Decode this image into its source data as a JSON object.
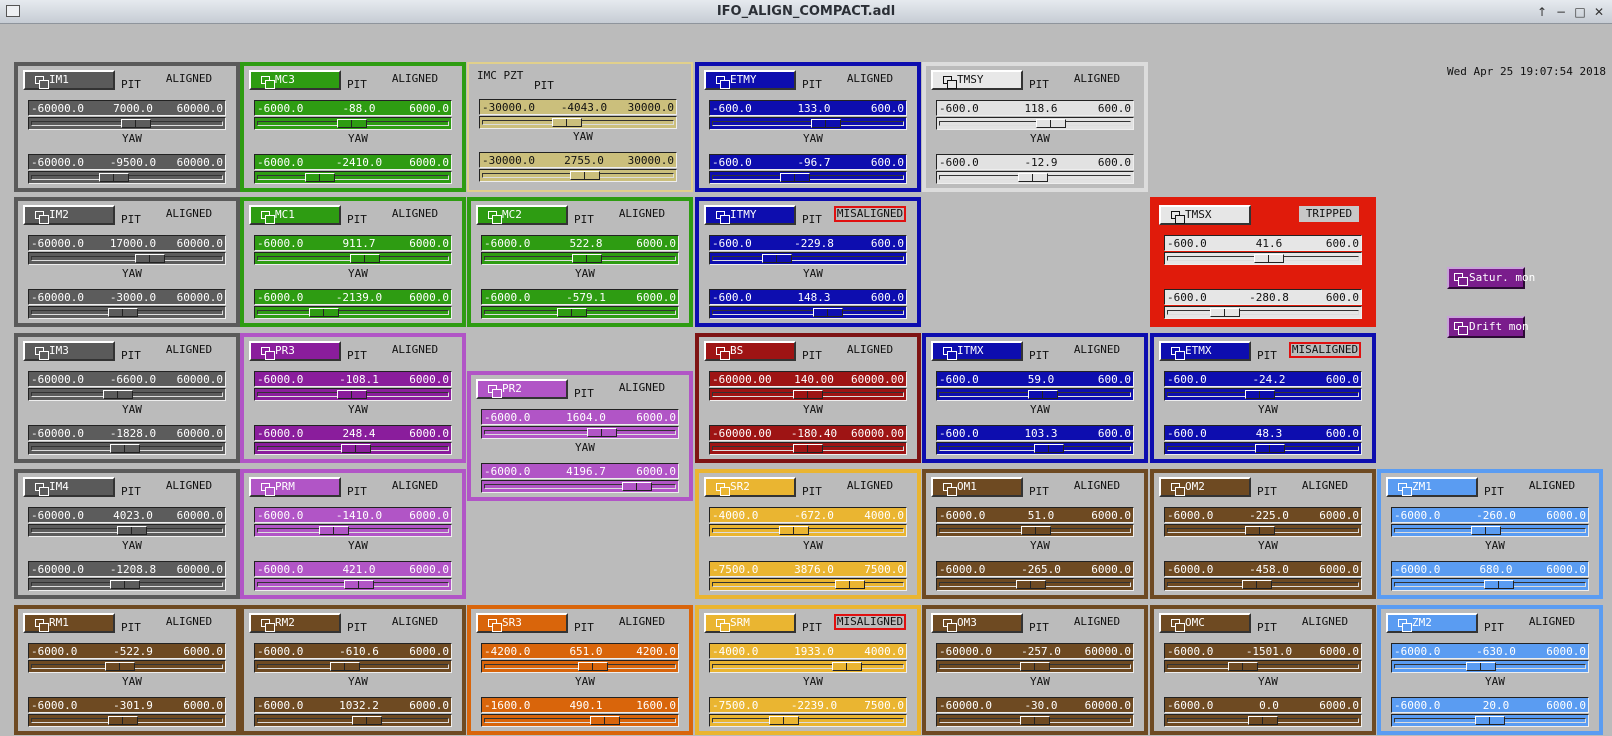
{
  "window": {
    "title": "IFO_ALIGN_COMPACT.adl",
    "controls": [
      "↑",
      "−",
      "□",
      "✕"
    ]
  },
  "clock": "Wed Apr 25 19:07:54 2018",
  "labels": {
    "pit": "PIT",
    "yaw": "YAW"
  },
  "side_buttons": [
    {
      "label": "Satur. mon"
    },
    {
      "label": "Drift mon"
    }
  ],
  "colors": {
    "gray": {
      "border": "#5a5a5a",
      "btn": "#5a5a5a",
      "fill": "#5c5c5c",
      "text": "#fff"
    },
    "green": {
      "border": "#2e9c12",
      "btn": "#2e9c12",
      "fill": "#2e9c12",
      "text": "#fff"
    },
    "pzt": {
      "border": "#e1d08c",
      "fill": "#cbbf7c",
      "text": "#111"
    },
    "blue": {
      "border": "#0d0daf",
      "btn": "#0d0daf",
      "fill": "#0d0daf",
      "text": "#fff"
    },
    "silver": {
      "border": "#dcdcdc",
      "btn": "#e8e8e8",
      "fill": "#e2e2e2",
      "text": "#111"
    },
    "purple": {
      "border": "#b155c6",
      "btn": "#8a1d9c",
      "fill": "#8a1d9c",
      "text": "#fff"
    },
    "lilac": {
      "border": "#b155c6",
      "btn": "#b155c6",
      "fill": "#b155c6",
      "text": "#fff"
    },
    "maroon": {
      "border": "#7e1313",
      "btn": "#9e1414",
      "fill": "#9e1414",
      "text": "#fff"
    },
    "yellow": {
      "border": "#eab531",
      "btn": "#eab531",
      "fill": "#eab531",
      "text": "#fff"
    },
    "brown": {
      "border": "#6e4a22",
      "btn": "#6e4a22",
      "fill": "#6e4a22",
      "text": "#fff"
    },
    "orange": {
      "border": "#d9650b",
      "btn": "#d9650b",
      "fill": "#d9650b",
      "text": "#fff"
    },
    "skyblue": {
      "border": "#5a9cf2",
      "btn": "#5a9cf2",
      "fill": "#5a9cf2",
      "text": "#fff"
    },
    "red": {
      "border": "#e01b0b",
      "fill": "#e6e6e6",
      "text": "#111"
    }
  },
  "panels": [
    {
      "name": "IM1",
      "theme": "gray",
      "status": "ALIGNED",
      "pit": {
        "lo": "-60000.0",
        "cur": "7000.0",
        "hi": "60000.0"
      },
      "yaw": {
        "lo": "-60000.0",
        "cur": "-9500.0",
        "hi": "60000.0"
      }
    },
    {
      "name": "MC3",
      "theme": "green",
      "status": "ALIGNED",
      "pit": {
        "lo": "-6000.0",
        "cur": "-88.0",
        "hi": "6000.0"
      },
      "yaw": {
        "lo": "-6000.0",
        "cur": "-2410.0",
        "hi": "6000.0"
      }
    },
    {
      "name": "IMC PZT",
      "theme": "pzt",
      "special": "pzt",
      "pit": {
        "lo": "-30000.0",
        "cur": "-4043.0",
        "hi": "30000.0"
      },
      "yaw": {
        "lo": "-30000.0",
        "cur": "2755.0",
        "hi": "30000.0"
      }
    },
    {
      "name": "ETMY",
      "theme": "blue",
      "status": "ALIGNED",
      "pit": {
        "lo": "-600.0",
        "cur": "133.0",
        "hi": "600.0"
      },
      "yaw": {
        "lo": "-600.0",
        "cur": "-96.7",
        "hi": "600.0"
      }
    },
    {
      "name": "TMSY",
      "theme": "silver",
      "status": "ALIGNED",
      "pit": {
        "lo": "-600.0",
        "cur": "118.6",
        "hi": "600.0"
      },
      "yaw": {
        "lo": "-600.0",
        "cur": "-12.9",
        "hi": "600.0"
      }
    },
    {
      "name": "IM2",
      "theme": "gray",
      "status": "ALIGNED",
      "pit": {
        "lo": "-60000.0",
        "cur": "17000.0",
        "hi": "60000.0"
      },
      "yaw": {
        "lo": "-60000.0",
        "cur": "-3000.0",
        "hi": "60000.0"
      }
    },
    {
      "name": "MC1",
      "theme": "green",
      "status": "ALIGNED",
      "pit": {
        "lo": "-6000.0",
        "cur": "911.7",
        "hi": "6000.0"
      },
      "yaw": {
        "lo": "-6000.0",
        "cur": "-2139.0",
        "hi": "6000.0"
      }
    },
    {
      "name": "MC2",
      "theme": "green",
      "status": "ALIGNED",
      "pit": {
        "lo": "-6000.0",
        "cur": "522.8",
        "hi": "6000.0"
      },
      "yaw": {
        "lo": "-6000.0",
        "cur": "-579.1",
        "hi": "6000.0"
      }
    },
    {
      "name": "ITMY",
      "theme": "blue",
      "status": "MISALIGNED",
      "pit": {
        "lo": "-600.0",
        "cur": "-229.8",
        "hi": "600.0"
      },
      "yaw": {
        "lo": "-600.0",
        "cur": "148.3",
        "hi": "600.0"
      }
    },
    {
      "name": "TMSX",
      "theme": "red",
      "status": "TRIPPED",
      "special": "tripped",
      "pit": {
        "lo": "-600.0",
        "cur": "41.6",
        "hi": "600.0"
      },
      "yaw": {
        "lo": "-600.0",
        "cur": "-280.8",
        "hi": "600.0"
      }
    },
    {
      "name": "IM3",
      "theme": "gray",
      "status": "ALIGNED",
      "pit": {
        "lo": "-60000.0",
        "cur": "-6600.0",
        "hi": "60000.0"
      },
      "yaw": {
        "lo": "-60000.0",
        "cur": "-1828.0",
        "hi": "60000.0"
      }
    },
    {
      "name": "PR3",
      "theme": "purple",
      "status": "ALIGNED",
      "pit": {
        "lo": "-6000.0",
        "cur": "-108.1",
        "hi": "6000.0"
      },
      "yaw": {
        "lo": "-6000.0",
        "cur": "248.4",
        "hi": "6000.0"
      }
    },
    {
      "name": "PR2",
      "theme": "lilac",
      "status": "ALIGNED",
      "pit": {
        "lo": "-6000.0",
        "cur": "1604.0",
        "hi": "6000.0"
      },
      "yaw": {
        "lo": "-6000.0",
        "cur": "4196.7",
        "hi": "6000.0"
      }
    },
    {
      "name": "BS",
      "theme": "maroon",
      "status": "ALIGNED",
      "pit": {
        "lo": "-60000.00",
        "cur": "140.00",
        "hi": "60000.00"
      },
      "yaw": {
        "lo": "-60000.00",
        "cur": "-180.40",
        "hi": "60000.00"
      }
    },
    {
      "name": "ITMX",
      "theme": "blue",
      "status": "ALIGNED",
      "pit": {
        "lo": "-600.0",
        "cur": "59.0",
        "hi": "600.0"
      },
      "yaw": {
        "lo": "-600.0",
        "cur": "103.3",
        "hi": "600.0"
      }
    },
    {
      "name": "ETMX",
      "theme": "blue",
      "status": "MISALIGNED",
      "pit": {
        "lo": "-600.0",
        "cur": "-24.2",
        "hi": "600.0"
      },
      "yaw": {
        "lo": "-600.0",
        "cur": "48.3",
        "hi": "600.0"
      }
    },
    {
      "name": "IM4",
      "theme": "gray",
      "status": "ALIGNED",
      "pit": {
        "lo": "-60000.0",
        "cur": "4023.0",
        "hi": "60000.0"
      },
      "yaw": {
        "lo": "-60000.0",
        "cur": "-1208.8",
        "hi": "60000.0"
      }
    },
    {
      "name": "PRM",
      "theme": "lilac",
      "status": "ALIGNED",
      "pit": {
        "lo": "-6000.0",
        "cur": "-1410.0",
        "hi": "6000.0"
      },
      "yaw": {
        "lo": "-6000.0",
        "cur": "421.0",
        "hi": "6000.0"
      }
    },
    {
      "name": "SR2",
      "theme": "yellow",
      "status": "ALIGNED",
      "pit": {
        "lo": "-4000.0",
        "cur": "-672.0",
        "hi": "4000.0"
      },
      "yaw": {
        "lo": "-7500.0",
        "cur": "3876.0",
        "hi": "7500.0"
      }
    },
    {
      "name": "OM1",
      "theme": "brown",
      "status": "ALIGNED",
      "pit": {
        "lo": "-6000.0",
        "cur": "51.0",
        "hi": "6000.0"
      },
      "yaw": {
        "lo": "-6000.0",
        "cur": "-265.0",
        "hi": "6000.0"
      }
    },
    {
      "name": "OM2",
      "theme": "brown",
      "status": "ALIGNED",
      "pit": {
        "lo": "-6000.0",
        "cur": "-225.0",
        "hi": "6000.0"
      },
      "yaw": {
        "lo": "-6000.0",
        "cur": "-458.0",
        "hi": "6000.0"
      }
    },
    {
      "name": "ZM1",
      "theme": "skyblue",
      "status": "ALIGNED",
      "pit": {
        "lo": "-6000.0",
        "cur": "-260.0",
        "hi": "6000.0"
      },
      "yaw": {
        "lo": "-6000.0",
        "cur": "680.0",
        "hi": "6000.0"
      }
    },
    {
      "name": "RM1",
      "theme": "brown",
      "status": "ALIGNED",
      "pit": {
        "lo": "-6000.0",
        "cur": "-522.9",
        "hi": "6000.0"
      },
      "yaw": {
        "lo": "-6000.0",
        "cur": "-301.9",
        "hi": "6000.0"
      }
    },
    {
      "name": "RM2",
      "theme": "brown",
      "status": "ALIGNED",
      "pit": {
        "lo": "-6000.0",
        "cur": "-610.6",
        "hi": "6000.0"
      },
      "yaw": {
        "lo": "-6000.0",
        "cur": "1032.2",
        "hi": "6000.0"
      }
    },
    {
      "name": "SR3",
      "theme": "orange",
      "status": "ALIGNED",
      "pit": {
        "lo": "-4200.0",
        "cur": "651.0",
        "hi": "4200.0"
      },
      "yaw": {
        "lo": "-1600.0",
        "cur": "490.1",
        "hi": "1600.0"
      }
    },
    {
      "name": "SRM",
      "theme": "yellow",
      "status": "MISALIGNED",
      "pit": {
        "lo": "-4000.0",
        "cur": "1933.0",
        "hi": "4000.0"
      },
      "yaw": {
        "lo": "-7500.0",
        "cur": "-2239.0",
        "hi": "7500.0"
      }
    },
    {
      "name": "OM3",
      "theme": "brown",
      "status": "ALIGNED",
      "pit": {
        "lo": "-60000.0",
        "cur": "-257.0",
        "hi": "60000.0"
      },
      "yaw": {
        "lo": "-60000.0",
        "cur": "-30.0",
        "hi": "60000.0"
      }
    },
    {
      "name": "OMC",
      "theme": "brown",
      "status": "ALIGNED",
      "pit": {
        "lo": "-6000.0",
        "cur": "-1501.0",
        "hi": "6000.0"
      },
      "yaw": {
        "lo": "-6000.0",
        "cur": "0.0",
        "hi": "6000.0"
      }
    },
    {
      "name": "ZM2",
      "theme": "skyblue",
      "status": "ALIGNED",
      "pit": {
        "lo": "-6000.0",
        "cur": "-630.0",
        "hi": "6000.0"
      },
      "yaw": {
        "lo": "-6000.0",
        "cur": "20.0",
        "hi": "6000.0"
      }
    }
  ]
}
